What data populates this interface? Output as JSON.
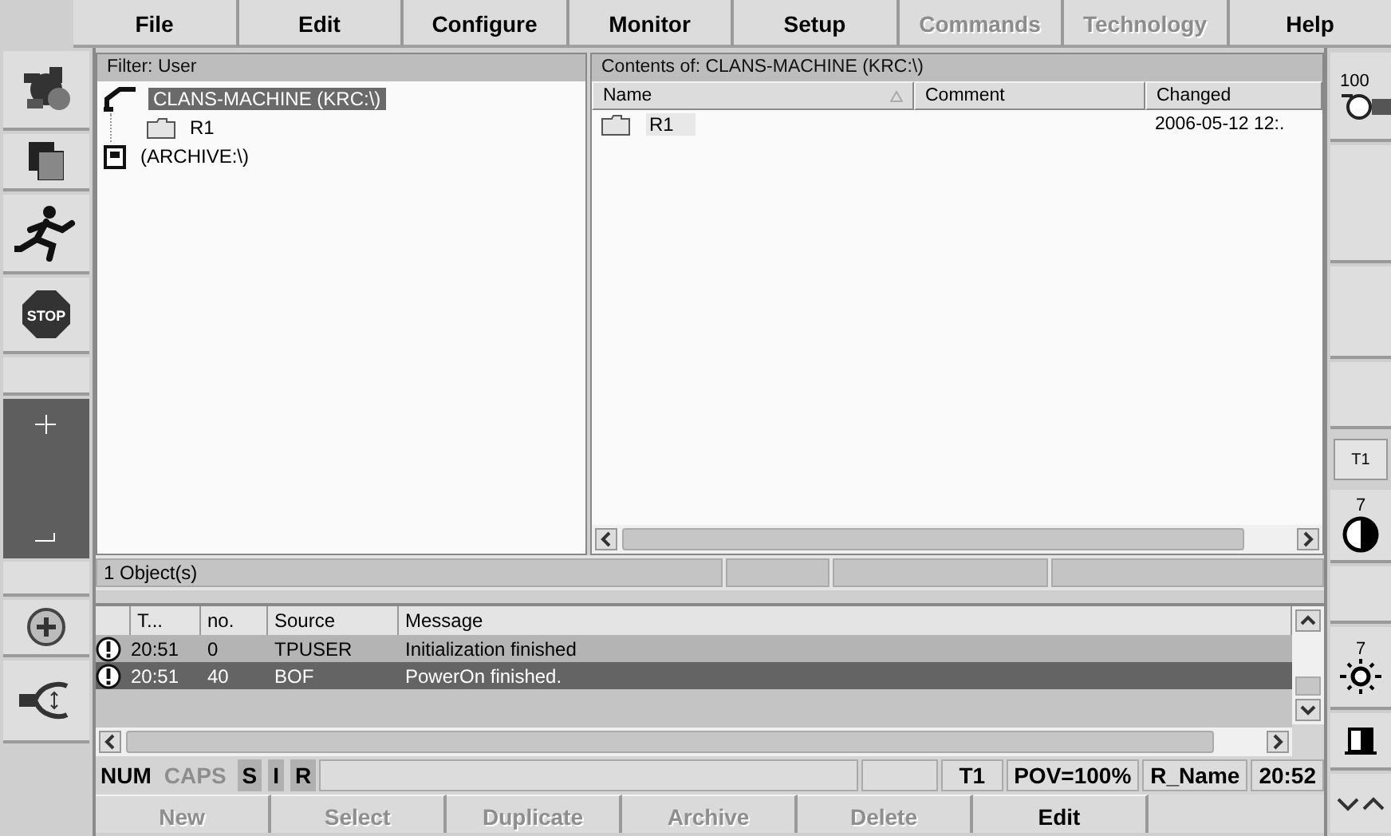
{
  "menu": [
    {
      "label": "File",
      "disabled": false
    },
    {
      "label": "Edit",
      "disabled": false
    },
    {
      "label": "Configure",
      "disabled": false
    },
    {
      "label": "Monitor",
      "disabled": false
    },
    {
      "label": "Setup",
      "disabled": false
    },
    {
      "label": "Commands",
      "disabled": true
    },
    {
      "label": "Technology",
      "disabled": true
    },
    {
      "label": "Help",
      "disabled": false
    }
  ],
  "tree": {
    "filter": "Filter: User",
    "items": [
      {
        "kind": "robot",
        "label": "CLANS-MACHINE (KRC:\\)",
        "selected": true,
        "children": [
          {
            "kind": "folder",
            "label": "R1",
            "selected": false
          }
        ]
      },
      {
        "kind": "drive",
        "label": "(ARCHIVE:\\)",
        "selected": false
      }
    ]
  },
  "contents": {
    "title": "Contents of: CLANS-MACHINE (KRC:\\)",
    "columns": [
      "Name",
      "Comment",
      "Changed"
    ],
    "rows": [
      {
        "name": "R1",
        "changed": "2006-05-12 12:."
      }
    ]
  },
  "object_count": "1 Object(s)",
  "messages": {
    "columns": [
      "T...",
      "no.",
      "Source",
      "Message"
    ],
    "rows": [
      {
        "time": "20:51",
        "no": "0",
        "source": "TPUSER",
        "message": "Initialization finished",
        "selected": false
      },
      {
        "time": "20:51",
        "no": "40",
        "source": "BOF",
        "message": "PowerOn finished.",
        "selected": true
      }
    ]
  },
  "status_bar": {
    "keys": [
      {
        "kind": "lock",
        "label": "NUM",
        "on": true
      },
      {
        "kind": "lock",
        "label": "CAPS",
        "on": false
      },
      {
        "kind": "flag",
        "label": "S",
        "on": true
      },
      {
        "kind": "flag",
        "label": "I",
        "on": true
      },
      {
        "kind": "flag",
        "label": "R",
        "on": true
      }
    ],
    "fields": [
      "T1",
      "POV=100%",
      "R_Name",
      "20:52"
    ]
  },
  "softkeys": [
    {
      "label": "New",
      "disabled": true
    },
    {
      "label": "Select",
      "disabled": true
    },
    {
      "label": "Duplicate",
      "disabled": true
    },
    {
      "label": "Archive",
      "disabled": true
    },
    {
      "label": "Delete",
      "disabled": true
    },
    {
      "label": "Edit",
      "disabled": false
    }
  ],
  "sidebar": {
    "stop_label": "STOP"
  },
  "right_panel": {
    "override": "100",
    "mode": "T1",
    "contrast": "7",
    "brightness": "7"
  }
}
